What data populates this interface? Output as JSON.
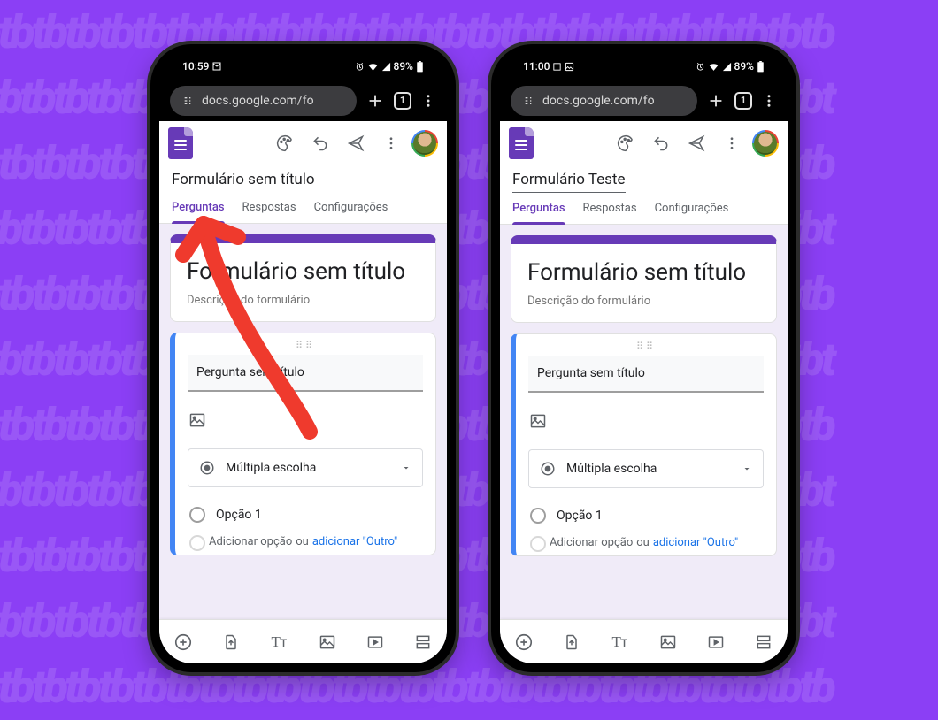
{
  "background_pattern_glyph": "tb",
  "phones": {
    "left": {
      "status": {
        "time": "10:59",
        "battery_pct": "89%"
      },
      "browser": {
        "url_text": "docs.google.com/fo"
      },
      "doc_title": "Formulário sem título",
      "doc_title_underlined": false,
      "tabs": {
        "questions": "Perguntas",
        "responses": "Respostas",
        "settings": "Configurações",
        "active": "questions"
      },
      "form": {
        "title": "Formulário sem título",
        "description": "Descrição do formulário"
      },
      "question": {
        "placeholder_text": "Pergunta sem título",
        "type_label": "Múltipla escolha",
        "option1": "Opção 1",
        "add_option": "Adicionar opção",
        "or": "ou",
        "add_other": "adicionar \"Outro\""
      }
    },
    "right": {
      "status": {
        "time": "11:00",
        "battery_pct": "89%"
      },
      "browser": {
        "url_text": "docs.google.com/fo"
      },
      "doc_title": "Formulário Teste",
      "doc_title_underlined": true,
      "tabs": {
        "questions": "Perguntas",
        "responses": "Respostas",
        "settings": "Configurações",
        "active": "questions"
      },
      "form": {
        "title": "Formulário sem título",
        "description": "Descrição do formulário"
      },
      "question": {
        "placeholder_text": "Pergunta sem título",
        "type_label": "Múltipla escolha",
        "option1": "Opção 1",
        "add_option": "Adicionar opção",
        "or": "ou",
        "add_other": "adicionar \"Outro\""
      }
    }
  },
  "icons": {
    "palette": "palette-icon",
    "undo": "undo-icon",
    "send": "send-icon",
    "more": "more-icon",
    "image": "image-icon",
    "radio": "radio-icon",
    "caret": "caret-down-icon",
    "add_circle": "add-circle-icon",
    "import": "import-question-icon",
    "text": "text-icon",
    "video": "video-icon",
    "section": "section-icon",
    "plus": "plus-icon",
    "tab_count": "1",
    "site": "site-settings-icon"
  },
  "annotation": {
    "type": "arrow",
    "color": "#ef3a2d",
    "points_to": "doc_title_left"
  }
}
